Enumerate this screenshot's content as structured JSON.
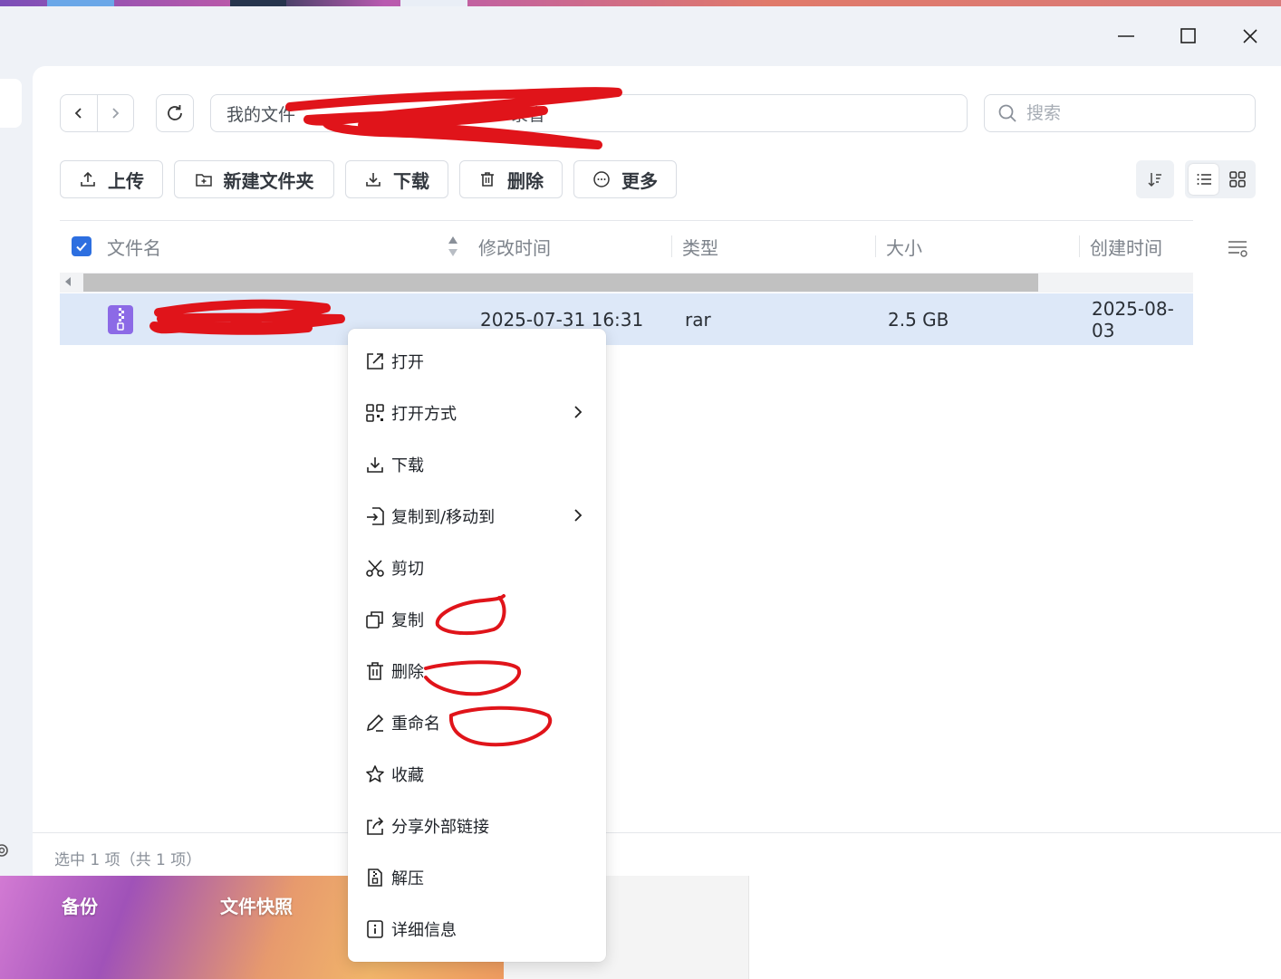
{
  "window": {
    "controls": {
      "minimize": "minimize",
      "maximize": "maximize",
      "close": "close"
    }
  },
  "toolbar": {
    "path_root": "我的文件",
    "path_tail": "录音",
    "search_placeholder": "搜索",
    "upload_label": "上传",
    "new_folder_label": "新建文件夹",
    "download_label": "下载",
    "delete_label": "删除",
    "more_label": "更多"
  },
  "table": {
    "columns": [
      "文件名",
      "修改时间",
      "类型",
      "大小",
      "创建时间"
    ],
    "rows": [
      {
        "name": "",
        "modified": "2025-07-31 16:31",
        "type": "rar",
        "size": "2.5 GB",
        "created": "2025-08-03"
      }
    ]
  },
  "status": {
    "text": "选中 1 项（共 1 项）"
  },
  "context_menu": {
    "items": [
      {
        "label": "打开",
        "icon": "open-external-icon"
      },
      {
        "label": "打开方式",
        "icon": "apps-grid-icon",
        "submenu": true
      },
      {
        "label": "下载",
        "icon": "download-icon"
      },
      {
        "label": "复制到/移动到",
        "icon": "move-to-icon",
        "submenu": true
      },
      {
        "label": "剪切",
        "icon": "scissors-icon"
      },
      {
        "label": "复制",
        "icon": "copy-icon"
      },
      {
        "label": "删除",
        "icon": "trash-icon"
      },
      {
        "label": "重命名",
        "icon": "pencil-icon"
      },
      {
        "label": "收藏",
        "icon": "star-icon"
      },
      {
        "label": "分享外部链接",
        "icon": "share-icon"
      },
      {
        "label": "解压",
        "icon": "extract-icon"
      },
      {
        "label": "详细信息",
        "icon": "info-icon"
      }
    ]
  },
  "background": {
    "tiles": [
      "备份",
      "文件快照"
    ]
  },
  "colors": {
    "accent": "#2d6fe0",
    "selected_row": "#dde8f8",
    "annotation": "#e0141a"
  }
}
